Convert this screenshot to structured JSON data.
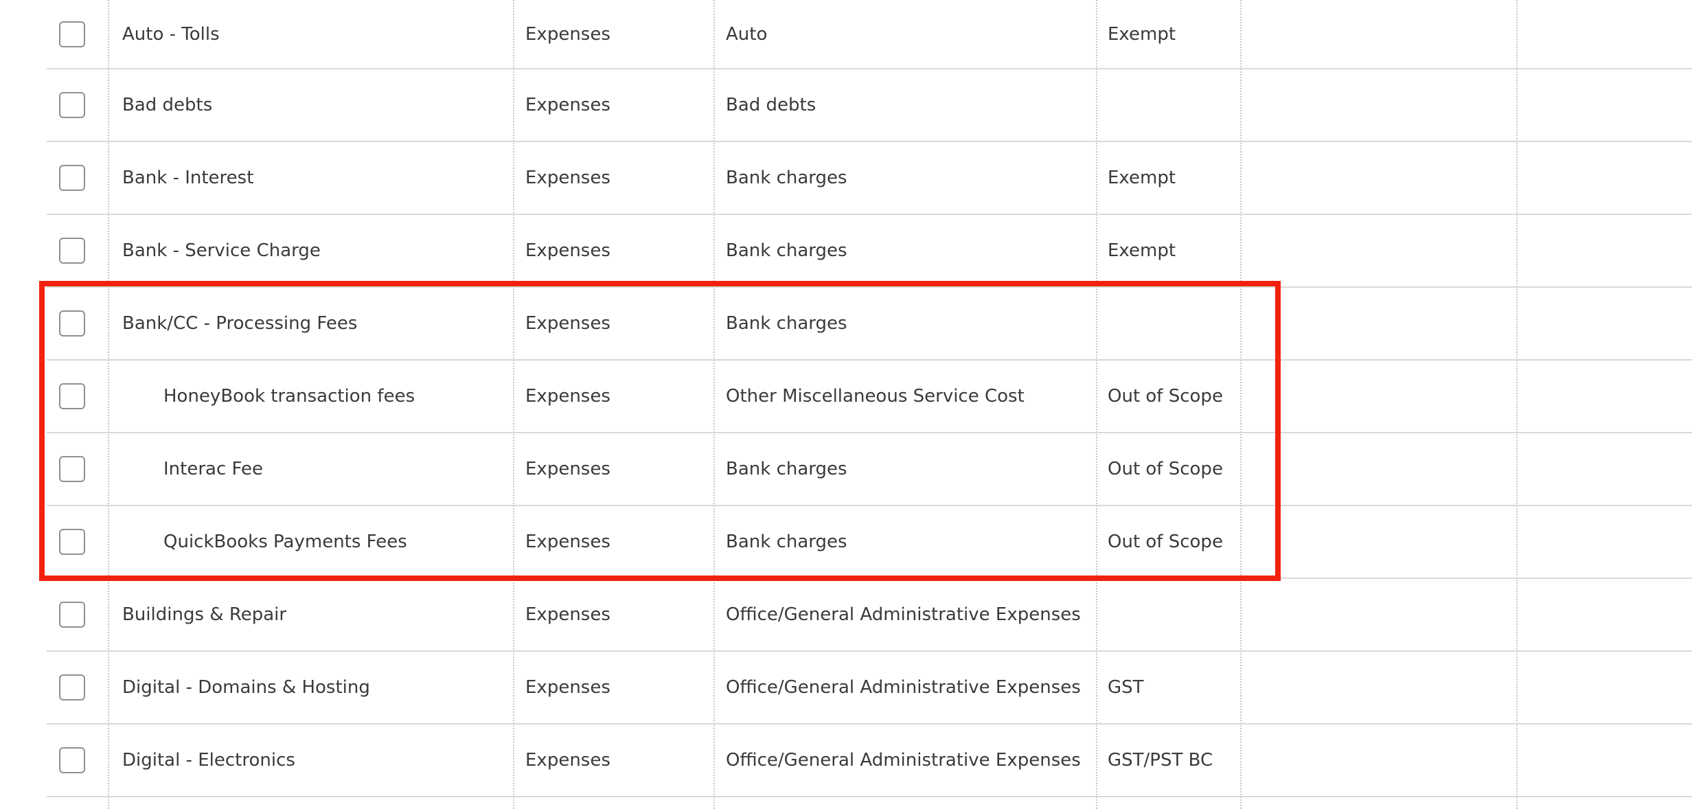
{
  "accounts": {
    "rows": [
      {
        "name": "Auto - Tolls",
        "type": "Expenses",
        "detail": "Auto",
        "tax": "Exempt"
      },
      {
        "name": "Bad debts",
        "type": "Expenses",
        "detail": "Bad debts",
        "tax": ""
      },
      {
        "name": "Bank - Interest",
        "type": "Expenses",
        "detail": "Bank charges",
        "tax": "Exempt"
      },
      {
        "name": "Bank - Service Charge",
        "type": "Expenses",
        "detail": "Bank charges",
        "tax": "Exempt"
      },
      {
        "name": "Bank/CC - Processing Fees",
        "type": "Expenses",
        "detail": "Bank charges",
        "tax": ""
      },
      {
        "name": "HoneyBook transaction fees",
        "type": "Expenses",
        "detail": "Other Miscellaneous Service Cost",
        "tax": "Out of Scope"
      },
      {
        "name": "Interac Fee",
        "type": "Expenses",
        "detail": "Bank charges",
        "tax": "Out of Scope"
      },
      {
        "name": "QuickBooks Payments Fees",
        "type": "Expenses",
        "detail": "Bank charges",
        "tax": "Out of Scope"
      },
      {
        "name": "Buildings & Repair",
        "type": "Expenses",
        "detail": "Office/General Administrative Expenses",
        "tax": ""
      },
      {
        "name": "Digital - Domains & Hosting",
        "type": "Expenses",
        "detail": "Office/General Administrative Expenses",
        "tax": "GST"
      },
      {
        "name": "Digital - Electronics",
        "type": "Expenses",
        "detail": "Office/General Administrative Expenses",
        "tax": "GST/PST BC"
      }
    ]
  },
  "colors": {
    "highlight": "#f2220f",
    "text": "#393a3d",
    "divider": "#d9d9d9"
  }
}
